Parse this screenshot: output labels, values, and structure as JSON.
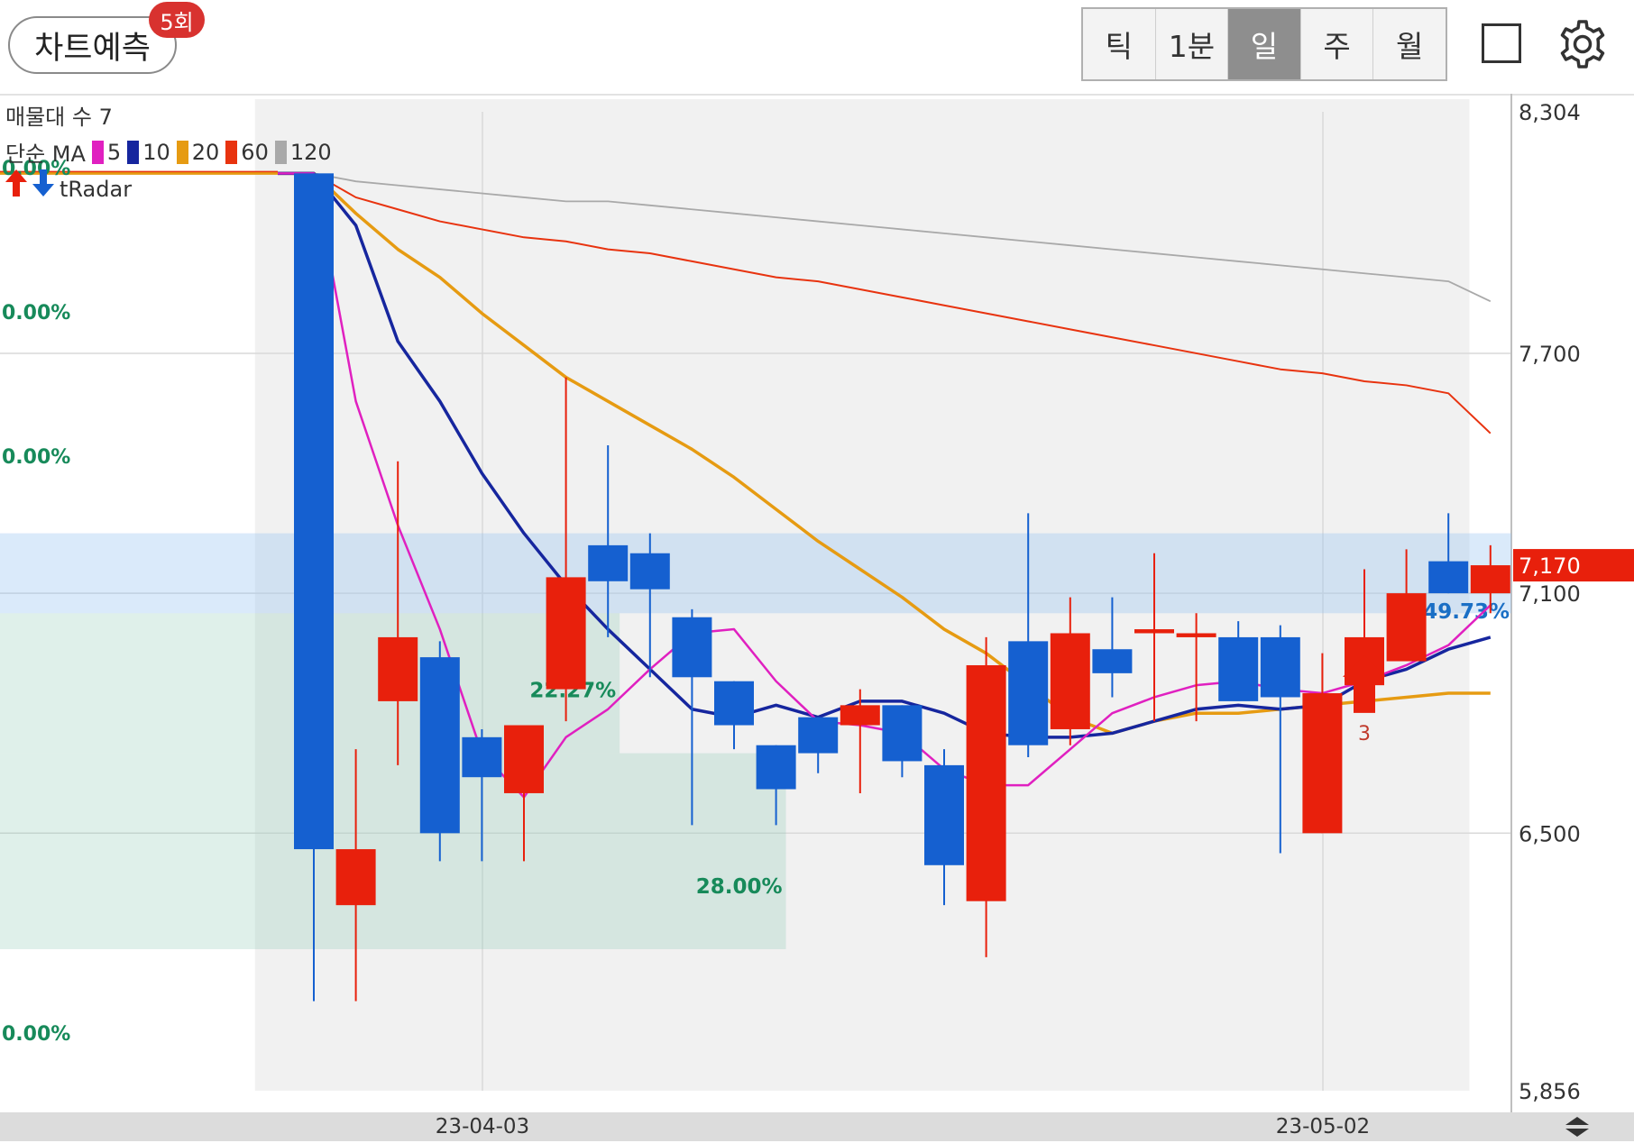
{
  "header": {
    "predict_label": "차트예측",
    "predict_badge": "5회",
    "periods": [
      {
        "label": "틱",
        "active": false
      },
      {
        "label": "1분",
        "active": false
      },
      {
        "label": "일",
        "active": true
      },
      {
        "label": "주",
        "active": false
      },
      {
        "label": "월",
        "active": false
      }
    ],
    "square_icon": "square-outline-icon",
    "settings_icon": "gear-icon"
  },
  "indicators": {
    "volume_profile_label": "매물대 수 7",
    "ma_label": "단순 MA",
    "ma_items": [
      {
        "period": "5",
        "color": "#e020c0"
      },
      {
        "period": "10",
        "color": "#16269e"
      },
      {
        "period": "20",
        "color": "#e69b12"
      },
      {
        "period": "60",
        "color": "#e8330f"
      },
      {
        "period": "120",
        "color": "#a9a9a9"
      }
    ],
    "tradar_label": "tRadar"
  },
  "chart_data": {
    "type": "candlestick",
    "interval": "daily",
    "ylim": [
      5856,
      8304
    ],
    "y_ticks": [
      "8,304",
      "7,700",
      "7,100",
      "6,500",
      "5,856"
    ],
    "x_labels": [
      "23-04-03",
      "23-05-02"
    ],
    "current_price": "7,170",
    "colors": {
      "up": "#e8200c",
      "down": "#1560d0",
      "ma5": "#e020c0",
      "ma10": "#16269e",
      "ma20": "#e69b12",
      "ma60": "#e8330f",
      "ma120": "#a9a9a9"
    },
    "flat_start_price": 8150,
    "candles": [
      {
        "o": 8150,
        "h": 8150,
        "l": 6080,
        "c": 6460
      },
      {
        "o": 6320,
        "h": 6710,
        "l": 6080,
        "c": 6460
      },
      {
        "o": 6830,
        "h": 7430,
        "l": 6670,
        "c": 6990
      },
      {
        "o": 6940,
        "h": 6980,
        "l": 6430,
        "c": 6500
      },
      {
        "o": 6740,
        "h": 6760,
        "l": 6430,
        "c": 6640
      },
      {
        "o": 6600,
        "h": 6760,
        "l": 6430,
        "c": 6770
      },
      {
        "o": 6860,
        "h": 7640,
        "l": 6780,
        "c": 7140
      },
      {
        "o": 7220,
        "h": 7470,
        "l": 6990,
        "c": 7130
      },
      {
        "o": 7200,
        "h": 7250,
        "l": 6890,
        "c": 7110
      },
      {
        "o": 7040,
        "h": 7060,
        "l": 6520,
        "c": 6890
      },
      {
        "o": 6880,
        "h": 6880,
        "l": 6710,
        "c": 6770
      },
      {
        "o": 6720,
        "h": 6720,
        "l": 6520,
        "c": 6610
      },
      {
        "o": 6790,
        "h": 6790,
        "l": 6650,
        "c": 6700
      },
      {
        "o": 6770,
        "h": 6860,
        "l": 6600,
        "c": 6820
      },
      {
        "o": 6820,
        "h": 6820,
        "l": 6640,
        "c": 6680
      },
      {
        "o": 6670,
        "h": 6710,
        "l": 6320,
        "c": 6420
      },
      {
        "o": 6330,
        "h": 6990,
        "l": 6190,
        "c": 6920
      },
      {
        "o": 6980,
        "h": 7300,
        "l": 6690,
        "c": 6720
      },
      {
        "o": 6760,
        "h": 7090,
        "l": 6720,
        "c": 7000
      },
      {
        "o": 6960,
        "h": 7090,
        "l": 6840,
        "c": 6900
      },
      {
        "o": 7000,
        "h": 7200,
        "l": 6780,
        "c": 7010
      },
      {
        "o": 6990,
        "h": 7050,
        "l": 6780,
        "c": 7000
      },
      {
        "o": 6990,
        "h": 7030,
        "l": 6850,
        "c": 6830
      },
      {
        "o": 6990,
        "h": 7020,
        "l": 6450,
        "c": 6840
      },
      {
        "o": 6500,
        "h": 6950,
        "l": 6500,
        "c": 6850
      },
      {
        "o": 6870,
        "h": 7160,
        "l": 6880,
        "c": 6990
      },
      {
        "o": 6930,
        "h": 7210,
        "l": 6930,
        "c": 7100
      },
      {
        "o": 7180,
        "h": 7300,
        "l": 7100,
        "c": 7100
      },
      {
        "o": 7100,
        "h": 7220,
        "l": 7050,
        "c": 7170
      }
    ],
    "ma_series": {
      "5": [
        8150,
        7580,
        7270,
        7010,
        6700,
        6590,
        6740,
        6810,
        6910,
        7000,
        7010,
        6880,
        6780,
        6770,
        6750,
        6660,
        6620,
        6620,
        6710,
        6800,
        6840,
        6870,
        6880,
        6860,
        6850,
        6880,
        6920,
        6970,
        7070
      ],
      "10": [
        8150,
        8020,
        7730,
        7580,
        7400,
        7250,
        7120,
        7010,
        6910,
        6810,
        6790,
        6820,
        6790,
        6830,
        6830,
        6800,
        6750,
        6740,
        6740,
        6750,
        6780,
        6810,
        6820,
        6810,
        6820,
        6880,
        6910,
        6960,
        6990
      ],
      "20": [
        8150,
        8050,
        7960,
        7890,
        7800,
        7720,
        7640,
        7580,
        7520,
        7460,
        7390,
        7310,
        7230,
        7160,
        7090,
        7010,
        6950,
        6870,
        6790,
        6750,
        6780,
        6800,
        6800,
        6810,
        6820,
        6830,
        6840,
        6850,
        6850
      ],
      "60": [
        8150,
        8090,
        8060,
        8030,
        8010,
        7990,
        7980,
        7960,
        7950,
        7930,
        7910,
        7890,
        7880,
        7860,
        7840,
        7820,
        7800,
        7780,
        7760,
        7740,
        7720,
        7700,
        7680,
        7660,
        7650,
        7630,
        7620,
        7600,
        7500
      ],
      "120": [
        8150,
        8130,
        8120,
        8110,
        8100,
        8090,
        8080,
        8080,
        8070,
        8060,
        8050,
        8040,
        8030,
        8020,
        8010,
        8000,
        7990,
        7980,
        7970,
        7960,
        7950,
        7940,
        7930,
        7920,
        7910,
        7900,
        7890,
        7880,
        7830
      ]
    },
    "volume_profile": [
      {
        "from": 7050,
        "to": 7250,
        "length": 1,
        "label": "49.73%",
        "label_color": "#1a6fc5"
      },
      {
        "from": 6700,
        "to": 7050,
        "length": 0.41,
        "label": "22.27%",
        "label_color": "#178a5a"
      },
      {
        "from": 6210,
        "to": 6700,
        "length": 0.52,
        "label": "28.00%",
        "label_color": "#178a5a"
      }
    ],
    "left_percent_labels": [
      "0.00%",
      "0.00%",
      "0.00%",
      "0.00%"
    ],
    "signal_count": "3"
  }
}
